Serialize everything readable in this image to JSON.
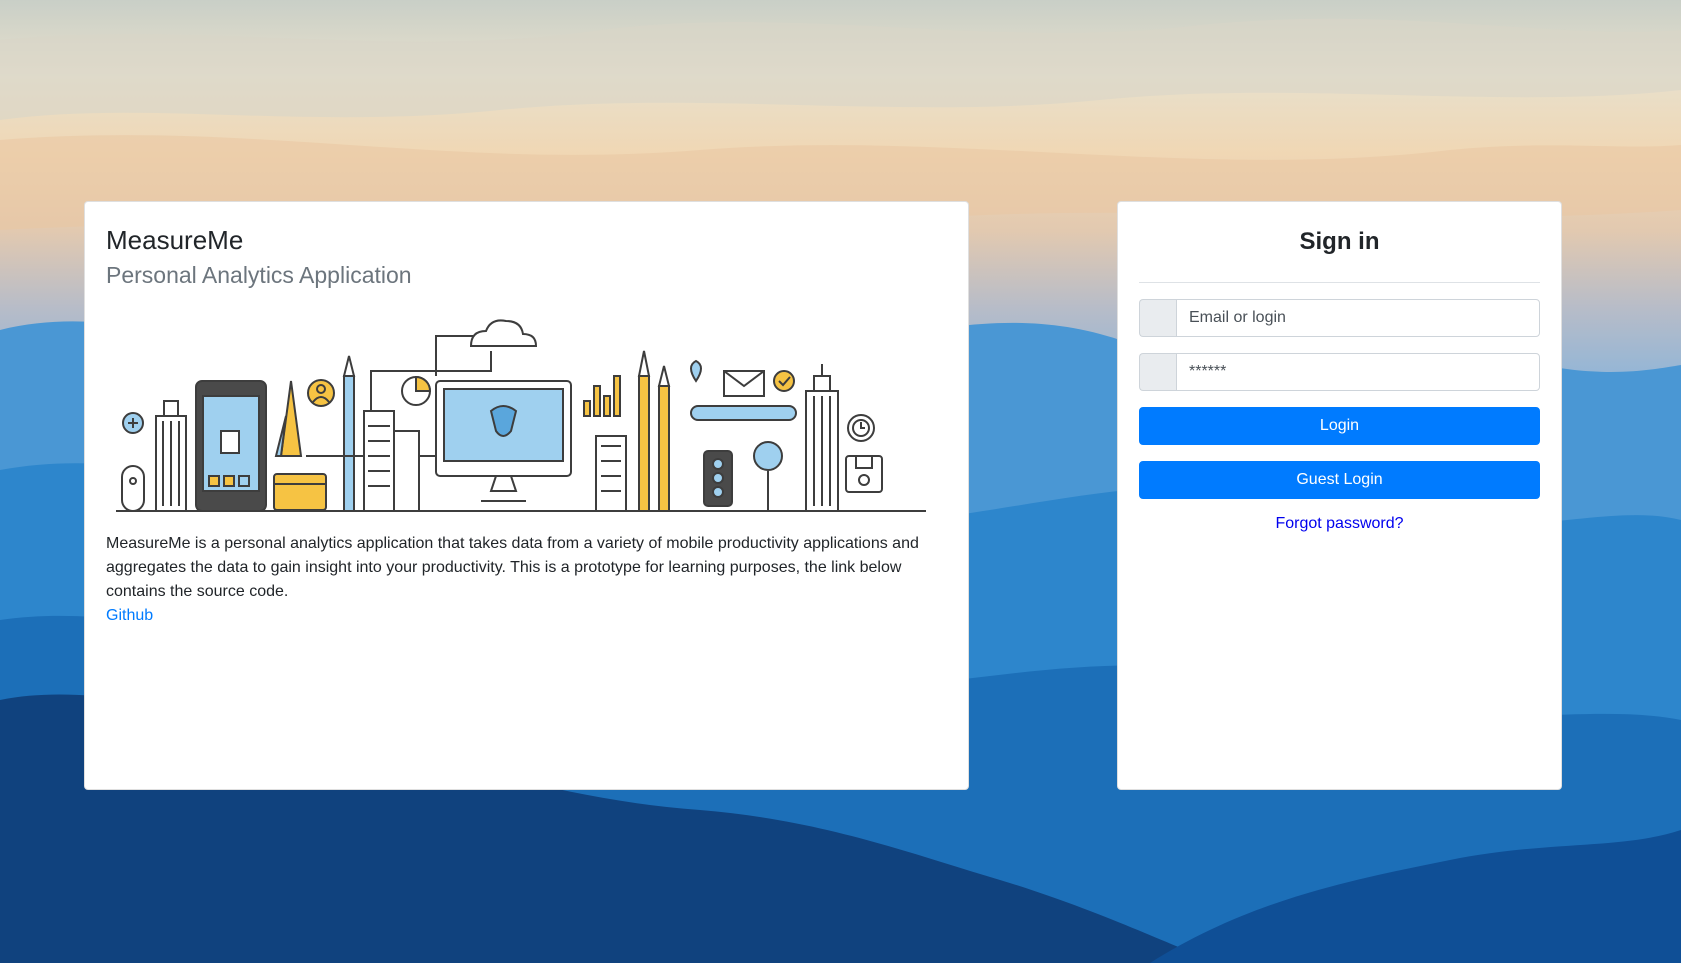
{
  "theme": {
    "primary": "#007bff",
    "muted_text": "#6c757d",
    "link": "#007bff",
    "card_bg": "#ffffff"
  },
  "info_card": {
    "title": "MeasureMe",
    "subtitle": "Personal Analytics Application",
    "description": "MeasureMe is a personal analytics application that takes data from a variety of mobile productivity applications and aggregates the data to gain insight into your productivity. This is a prototype for learning purposes, the link below contains the source code.",
    "link_label": "Github"
  },
  "login": {
    "title": "Sign in",
    "email_placeholder": "Email or login",
    "password_value": "******",
    "login_button": "Login",
    "guest_button": "Guest Login",
    "forgot_link": "Forgot password?"
  }
}
